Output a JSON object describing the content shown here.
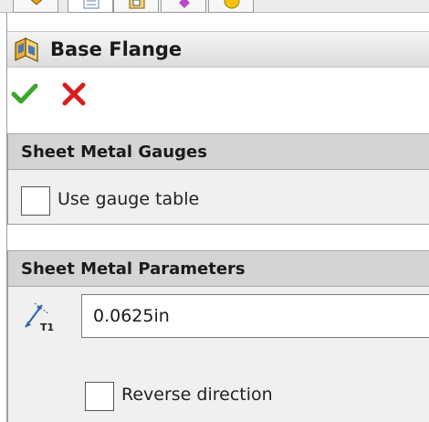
{
  "window": {
    "title": "Base Flange"
  },
  "tabs": [
    {
      "icon": "feature-manager-icon"
    },
    {
      "icon": "property-manager-icon"
    },
    {
      "icon": "configuration-manager-icon"
    },
    {
      "icon": "dimxpert-icon"
    },
    {
      "icon": "display-manager-icon"
    }
  ],
  "actions": {
    "ok_icon": "green-check-icon",
    "cancel_icon": "red-x-icon"
  },
  "gauges": {
    "header": "Sheet Metal Gauges",
    "use_gauge_table_label": "Use gauge table",
    "use_gauge_table_checked": false
  },
  "parameters": {
    "header": "Sheet Metal Parameters",
    "thickness_icon": "thickness-t1-icon",
    "thickness_value": "0.0625in",
    "reverse_direction_label": "Reverse direction",
    "reverse_direction_checked": false
  },
  "colors": {
    "ok": "#3aa52a",
    "cancel": "#d91c1c",
    "header_bg": "#d4d4d4",
    "panel_bg": "#f0f0f0"
  }
}
